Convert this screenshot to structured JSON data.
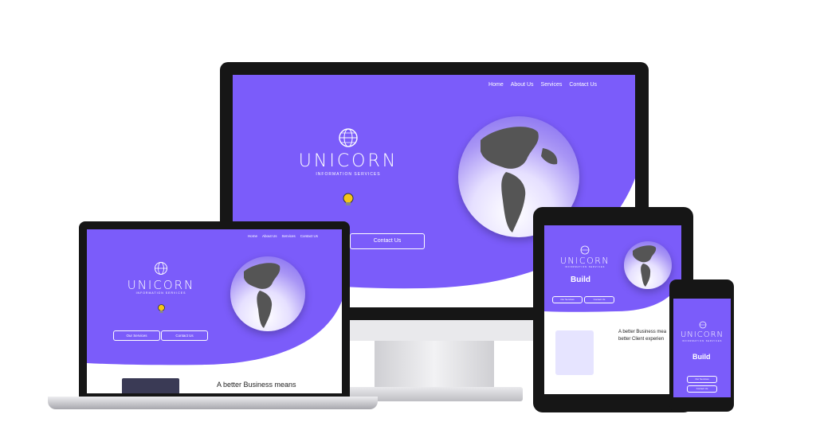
{
  "nav": {
    "home": "Home",
    "about": "About Us",
    "services": "Services",
    "contact": "Contact Us"
  },
  "brand": {
    "name": "UNICORN",
    "tagline": "INFORMATION SERVICES"
  },
  "buttons": {
    "our_services": "Our Services",
    "contact_us": "Contact Us"
  },
  "hero": {
    "build": "Build"
  },
  "section": {
    "heading_laptop": "A better Business means",
    "heading_tablet_1": "A better Business mea",
    "heading_tablet_2": "better Client experien"
  },
  "colors": {
    "brand_purple": "#7b5cfa",
    "device_black": "#1a1a1a",
    "globe_land": "#555555"
  },
  "icons": [
    "globe-logo-icon",
    "lightbulb-icon"
  ]
}
